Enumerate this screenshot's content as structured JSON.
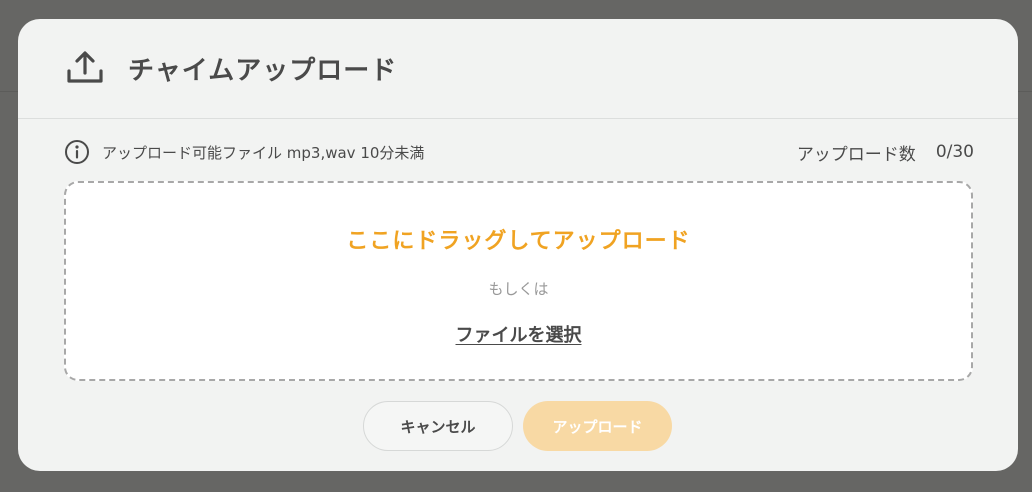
{
  "dialog": {
    "title": "チャイムアップロード",
    "header_icon": "upload-icon"
  },
  "info": {
    "icon": "info-circle-icon",
    "text": "アップロード可能ファイル mp3,wav 10分未満",
    "count_label": "アップロード数",
    "count_value": "0/30"
  },
  "dropzone": {
    "title": "ここにドラッグしてアップロード",
    "or_text": "もしくは",
    "select_link": "ファイルを選択"
  },
  "buttons": {
    "cancel": "キャンセル",
    "upload": "アップロード",
    "upload_disabled": true
  },
  "colors": {
    "accent": "#f0a322",
    "upload_button_disabled": "#f8d9a4",
    "modal_background": "#f2f3f2",
    "overlay": "#666664"
  }
}
